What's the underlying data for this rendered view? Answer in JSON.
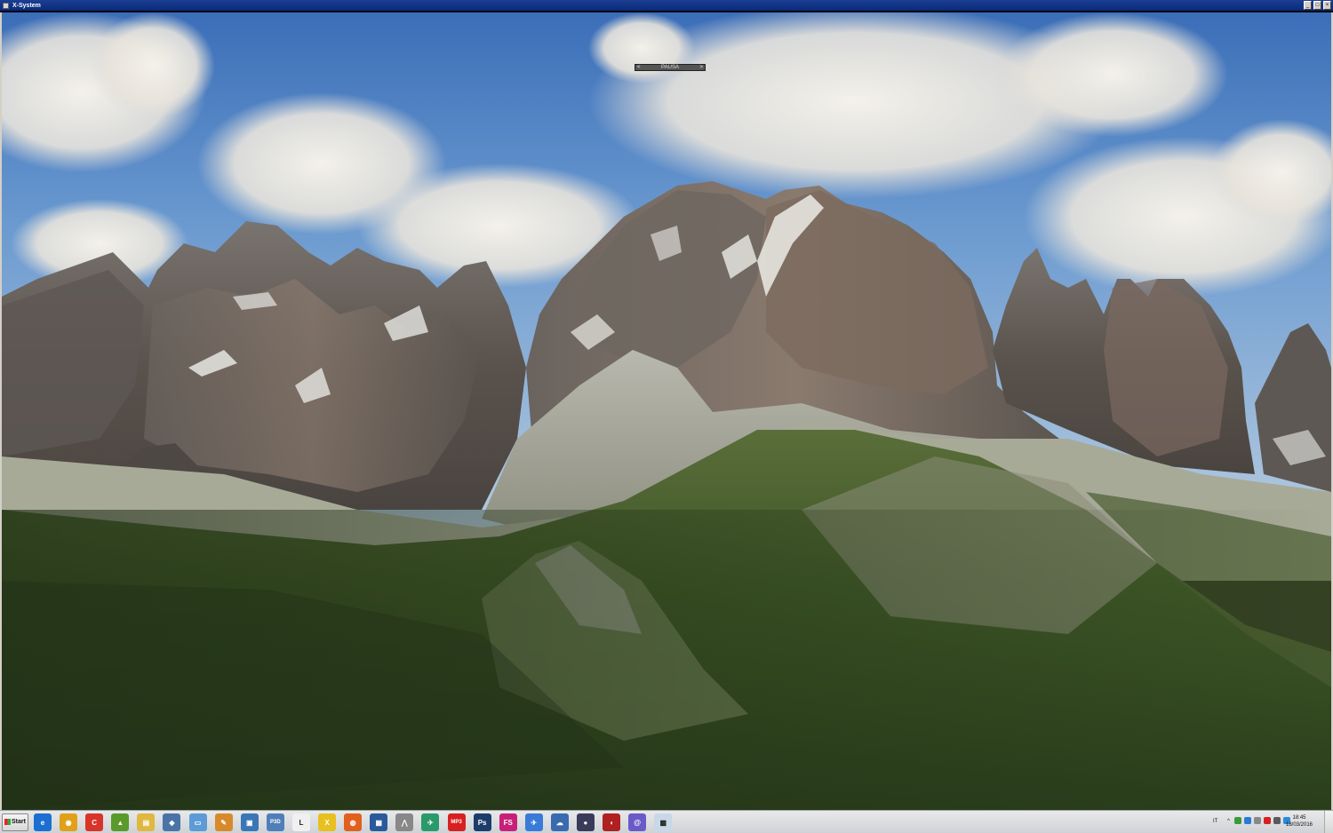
{
  "window": {
    "title": "X-System",
    "controls": {
      "minimize": "_",
      "maximize": "□",
      "close": "×"
    }
  },
  "simulator": {
    "pause_label": "PAUSA",
    "prev_arrow": "<",
    "next_arrow": ">"
  },
  "taskbar": {
    "start_label": "Start",
    "apps": [
      {
        "name": "internet-explorer",
        "glyph": "e",
        "color": "#1b6fd1"
      },
      {
        "name": "chrome",
        "glyph": "◉",
        "color": "#e0a018"
      },
      {
        "name": "ccleaner",
        "glyph": "C",
        "color": "#d8342a"
      },
      {
        "name": "android-tool",
        "glyph": "▲",
        "color": "#5a9a2a"
      },
      {
        "name": "file-explorer",
        "glyph": "▤",
        "color": "#e0b840"
      },
      {
        "name": "network-tool",
        "glyph": "◆",
        "color": "#4a74a8"
      },
      {
        "name": "notepad",
        "glyph": "▭",
        "color": "#5c9bd6"
      },
      {
        "name": "paint-tool",
        "glyph": "✎",
        "color": "#d88a2a"
      },
      {
        "name": "remote-desktop",
        "glyph": "▣",
        "color": "#3a76b6"
      },
      {
        "name": "prepar3d",
        "glyph": "P3D",
        "color": "#4f7fb8"
      },
      {
        "name": "text-editor",
        "glyph": "L",
        "color": "#f0f0f0"
      },
      {
        "name": "x-plane",
        "glyph": "X",
        "color": "#e8c020"
      },
      {
        "name": "firefox",
        "glyph": "◍",
        "color": "#e2601e"
      },
      {
        "name": "media-center",
        "glyph": "▦",
        "color": "#2a5a9a"
      },
      {
        "name": "route-planner",
        "glyph": "⋀",
        "color": "#888888"
      },
      {
        "name": "plane-maker",
        "glyph": "✈",
        "color": "#2a9a6a"
      },
      {
        "name": "mp3-converter",
        "glyph": "MP3",
        "color": "#d82020"
      },
      {
        "name": "photoshop",
        "glyph": "Ps",
        "color": "#1c3d6a"
      },
      {
        "name": "fs-tool",
        "glyph": "FS",
        "color": "#c8207a"
      },
      {
        "name": "flight-app",
        "glyph": "✈",
        "color": "#3a7ad8"
      },
      {
        "name": "cloud-app",
        "glyph": "☁",
        "color": "#3a6ab0"
      },
      {
        "name": "globe-app",
        "glyph": "●",
        "color": "#3a3a5a"
      },
      {
        "name": "red-app",
        "glyph": "◖",
        "color": "#b02020"
      },
      {
        "name": "spiral-app",
        "glyph": "@",
        "color": "#6a5ac8"
      },
      {
        "name": "scenery-tool",
        "glyph": "▩",
        "color": "#c8d8e8"
      }
    ],
    "tray": {
      "language": "IT",
      "chevron": "^",
      "icons": [
        "#3a9a3a",
        "#2a7ad8",
        "#888888",
        "#d82020",
        "#5a5a5a",
        "#2a8ad8"
      ],
      "time": "18:45",
      "date": "18/03/2016"
    }
  }
}
